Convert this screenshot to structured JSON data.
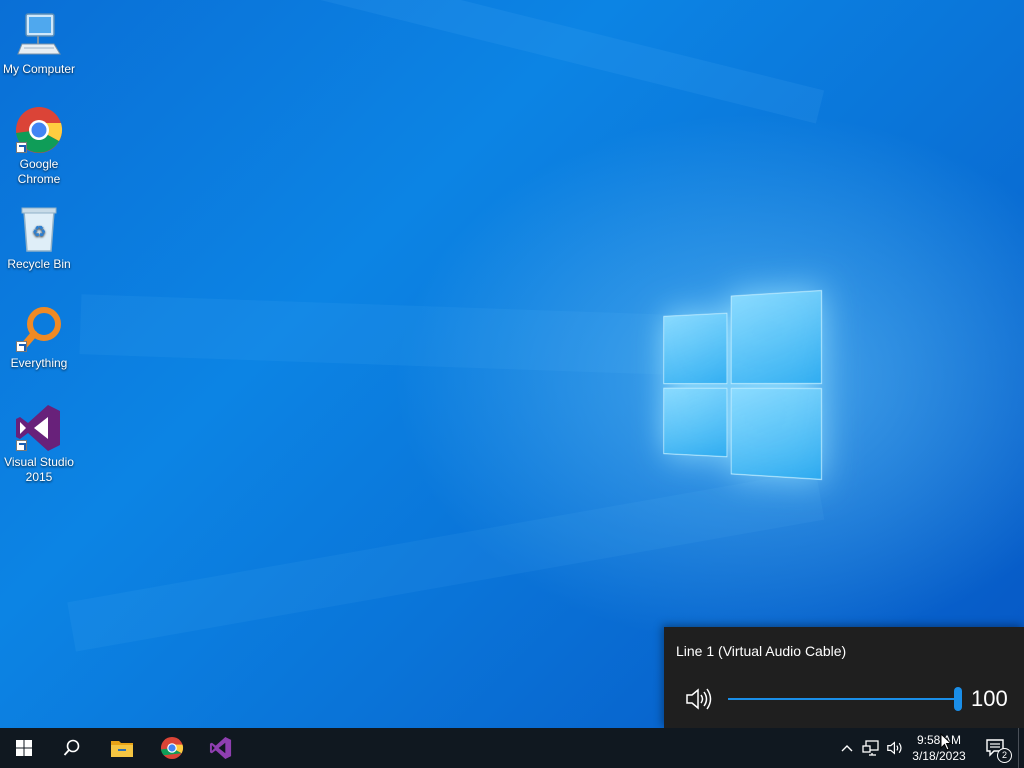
{
  "desktop": {
    "icons": [
      {
        "label": "My Computer",
        "icon": "computer-icon"
      },
      {
        "label": "Google Chrome",
        "icon": "chrome-icon",
        "shortcut": true
      },
      {
        "label": "Recycle Bin",
        "icon": "recycle-bin-icon"
      },
      {
        "label": "Everything",
        "icon": "everything-search-icon",
        "shortcut": true
      },
      {
        "label": "Visual Studio 2015",
        "icon": "visual-studio-icon",
        "shortcut": true
      }
    ]
  },
  "volume_flyout": {
    "device_name": "Line 1 (Virtual Audio Cable)",
    "speaker_icon": "speaker-icon",
    "volume_level": 100,
    "volume_label": "100",
    "accent": "#1a8ee8"
  },
  "taskbar": {
    "start_icon": "windows-start-icon",
    "search_icon": "search-icon",
    "pinned": [
      "file-explorer-icon",
      "chrome-icon",
      "visual-studio-icon"
    ],
    "tray": {
      "chevron_icon": "chevron-up-icon",
      "network_icon": "network-icon",
      "volume_icon": "speaker-icon"
    },
    "clock": {
      "time": "9:58 AM",
      "date": "3/18/2023"
    },
    "notifications": {
      "icon": "action-center-icon",
      "count": "2"
    }
  },
  "colors": {
    "desktop_blue": "#0a74d8",
    "taskbar": "#101820",
    "flyout": "#1f1f1f"
  }
}
